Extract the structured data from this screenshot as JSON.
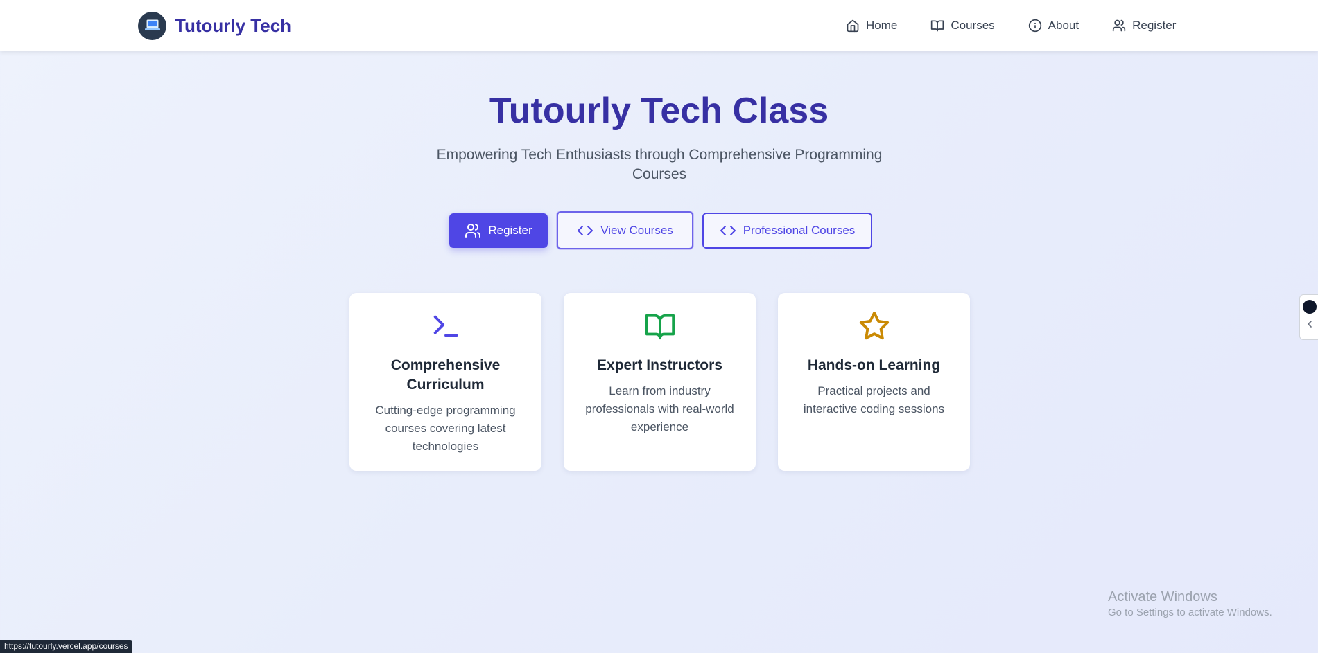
{
  "nav": {
    "brand": "Tutourly Tech",
    "links": [
      {
        "label": "Home",
        "icon": "home-icon"
      },
      {
        "label": "Courses",
        "icon": "book-icon"
      },
      {
        "label": "About",
        "icon": "info-icon"
      },
      {
        "label": "Register",
        "icon": "users-icon"
      }
    ]
  },
  "hero": {
    "title": "Tutourly Tech Class",
    "subtitle": "Empowering Tech Enthusiasts through Comprehensive Programming Courses",
    "buttons": {
      "register": "Register",
      "view_courses": "View Courses",
      "professional_courses": "Professional Courses"
    }
  },
  "features": [
    {
      "title": "Comprehensive Curriculum",
      "desc": "Cutting-edge programming courses covering latest technologies",
      "icon": "terminal-icon",
      "color": "#4f46e5"
    },
    {
      "title": "Expert Instructors",
      "desc": "Learn from industry professionals with real-world experience",
      "icon": "book-open-icon",
      "color": "#16a34a"
    },
    {
      "title": "Hands-on Learning",
      "desc": "Practical projects and interactive coding sessions",
      "icon": "star-icon",
      "color": "#ca8a04"
    }
  ],
  "system": {
    "activate_title": "Activate Windows",
    "activate_sub": "Go to Settings to activate Windows.",
    "status_url": "https://tutourly.vercel.app/courses"
  },
  "colors": {
    "primary": "#4f46e5",
    "brand": "#3730a3"
  }
}
